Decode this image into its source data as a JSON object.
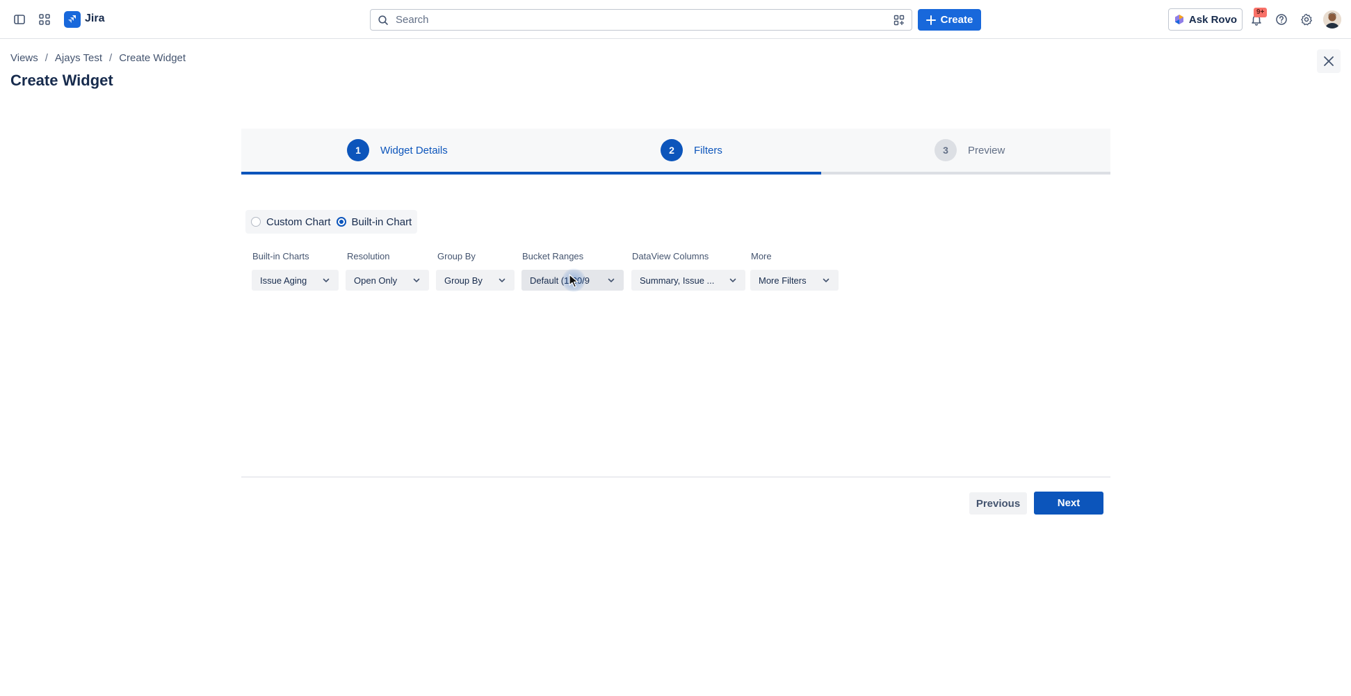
{
  "app": {
    "name": "Jira"
  },
  "search": {
    "placeholder": "Search"
  },
  "header": {
    "create_label": "Create",
    "ask_rovo_label": "Ask Rovo",
    "notifications_badge": "9+"
  },
  "breadcrumb": [
    "Views",
    "Ajays Test",
    "Create Widget"
  ],
  "page": {
    "title": "Create Widget"
  },
  "stepper": {
    "steps": [
      {
        "number": "1",
        "label": "Widget Details",
        "state": "active"
      },
      {
        "number": "2",
        "label": "Filters",
        "state": "active"
      },
      {
        "number": "3",
        "label": "Preview",
        "state": "inactive"
      }
    ],
    "progress_fraction": 0.667
  },
  "chart_type": {
    "options": [
      {
        "label": "Custom Chart",
        "checked": false
      },
      {
        "label": "Built-in Chart",
        "checked": true
      }
    ]
  },
  "filters": [
    {
      "label": "Built-in Charts",
      "value": "Issue Aging"
    },
    {
      "label": "Resolution",
      "value": "Open Only"
    },
    {
      "label": "Group By",
      "value": "Group By"
    },
    {
      "label": "Bucket Ranges",
      "value": "Default (1-30/9"
    },
    {
      "label": "DataView Columns",
      "value": "Summary, Issue ..."
    },
    {
      "label": "More",
      "value": "More Filters"
    }
  ],
  "footer": {
    "previous_label": "Previous",
    "next_label": "Next"
  },
  "colors": {
    "brand": "#1868db",
    "primary": "#0c55bb",
    "text": "#172b4d",
    "subtle_text": "#44546f",
    "badge": "#f87168"
  },
  "icons": [
    "sidebar-toggle-icon",
    "app-switcher-icon",
    "jira-logo-icon",
    "search-icon",
    "filter-icon",
    "plus-icon",
    "rovo-icon",
    "bell-icon",
    "help-icon",
    "gear-icon",
    "close-icon",
    "chevron-down-icon"
  ]
}
